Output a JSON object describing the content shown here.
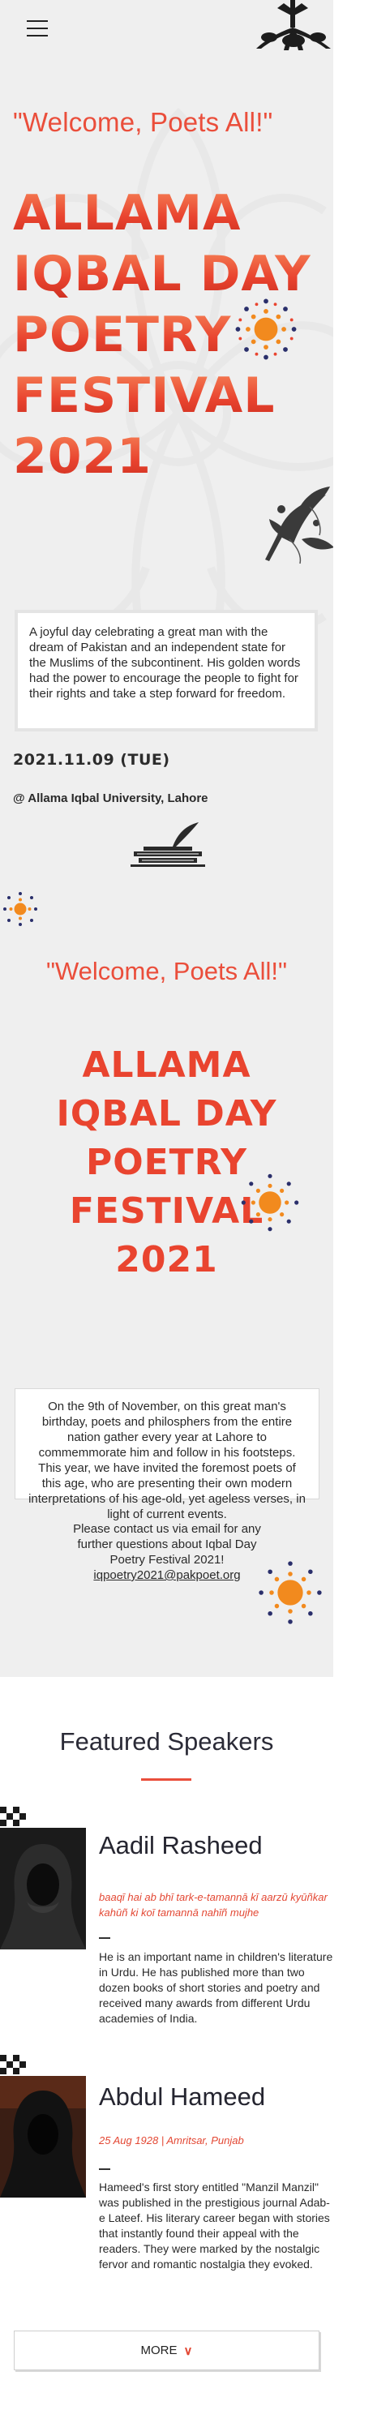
{
  "nav": {
    "menu_icon": "hamburger-menu-icon"
  },
  "hero": {
    "welcome": "\"Welcome, Poets All!\"",
    "title_lines": [
      "ALLAMA",
      "IQBAL DAY",
      "POETRY",
      "FESTIVAL",
      "2021"
    ],
    "intro": "A joyful day celebrating a great man with the dream of Pakistan and an independent state for the Muslims of the subcontinent. His golden words had the power to encourage the people to fight for their rights and take a step forward for freedom.",
    "date": "2021.11.09 (TUE)",
    "venue": "@ Allama Iqbal University, Lahore"
  },
  "second": {
    "welcome": "\"Welcome, Poets All!\"",
    "title_lines": [
      "ALLAMA",
      "IQBAL DAY",
      "POETRY",
      "FESTIVAL",
      "2021"
    ],
    "about": "On the 9th of November, on this great man's birthday, poets and philosphers from the entire nation gather every year at Lahore to commemmorate him and follow in his footsteps. This year, we have invited the foremost poets of this age, who are presenting their own modern interpretations of his age-old, yet ageless verses, in light of current events.",
    "contact_text": "Please contact us via email for any further questions about Iqbal Day Poetry Festival 2021!",
    "contact_email": "iqpoetry2021@pakpoet.org"
  },
  "speakers": {
    "title": "Featured Speakers",
    "items": [
      {
        "name": "Aadil Rasheed",
        "subtitle": "baaqī hai ab bhī tark-e-tamannā kī aarzū kyūñkar kahūñ ki koī tamannā nahīñ mujhe",
        "bio": "He is an important name in children's literature in Urdu. He has published more than two dozen books of short stories and poetry and received many awards from different Urdu academies of India."
      },
      {
        "name": "Abdul Hameed",
        "subtitle": "25 Aug 1928 | Amritsar, Punjab",
        "bio": "Hameed's first story entitled \"Manzil Manzil\" was published in the prestigious journal Adab-e Lateef. His literary career began with stories that instantly found their appeal with the readers. They were marked by the nostalgic fervor and romantic nostalgia they evoked."
      }
    ],
    "more_label": "MORE",
    "more_icon": "chevron-down-icon"
  },
  "colors": {
    "accent": "#ea4e3b",
    "burst_orange": "#f28a1e",
    "burst_navy": "#2a2f6b",
    "band_gray": "#efefef"
  }
}
